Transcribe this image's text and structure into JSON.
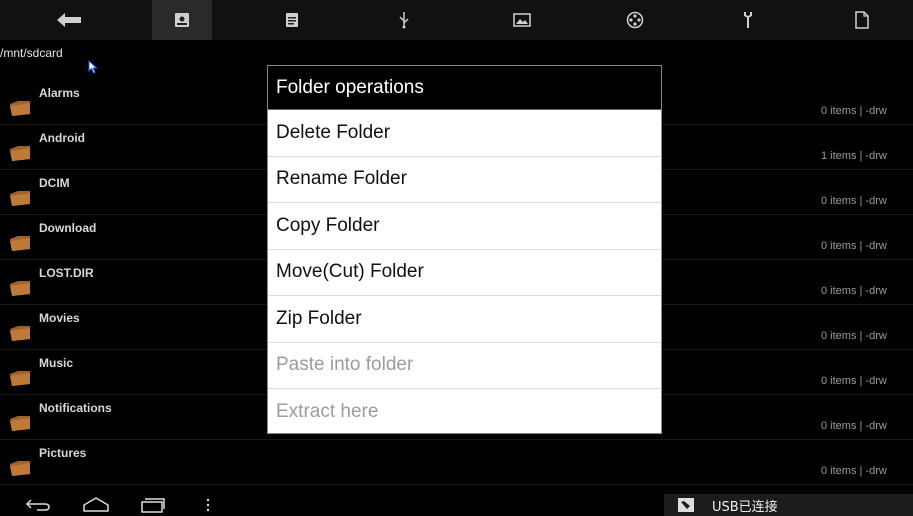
{
  "toolbar": {
    "buttons": [
      {
        "icon": "back-arrow-icon"
      },
      {
        "icon": "sdcard-icon",
        "active": true
      },
      {
        "icon": "document-icon"
      },
      {
        "icon": "usb-icon"
      },
      {
        "icon": "picture-icon"
      },
      {
        "icon": "film-reel-icon"
      },
      {
        "icon": "wrench-icon"
      },
      {
        "icon": "file-icon"
      }
    ]
  },
  "path": "/mnt/sdcard",
  "folders": [
    {
      "name": "Alarms",
      "meta": "0 items | -drw"
    },
    {
      "name": "Android",
      "meta": "1 items | -drw"
    },
    {
      "name": "DCIM",
      "meta": "0 items | -drw"
    },
    {
      "name": "Download",
      "meta": "0 items | -drw"
    },
    {
      "name": "LOST.DIR",
      "meta": "0 items | -drw"
    },
    {
      "name": "Movies",
      "meta": "0 items | -drw"
    },
    {
      "name": "Music",
      "meta": "0 items | -drw"
    },
    {
      "name": "Notifications",
      "meta": "0 items | -drw"
    },
    {
      "name": "Pictures",
      "meta": "0 items | -drw"
    }
  ],
  "dialog": {
    "title": "Folder operations",
    "items": [
      {
        "label": "Delete Folder",
        "enabled": true
      },
      {
        "label": "Rename Folder",
        "enabled": true
      },
      {
        "label": "Copy Folder",
        "enabled": true
      },
      {
        "label": "Move(Cut) Folder",
        "enabled": true
      },
      {
        "label": "Zip Folder",
        "enabled": true
      },
      {
        "label": "Paste into folder",
        "enabled": false
      },
      {
        "label": "Extract here",
        "enabled": false
      }
    ]
  },
  "navbar": {
    "buttons": [
      "back-icon",
      "home-icon",
      "recent-apps-icon",
      "menu-icon"
    ]
  },
  "notification": {
    "text": "USB已连接"
  },
  "colors": {
    "folder": "#a0612a",
    "toolbar_icon": "#cfcfcf",
    "disabled_text": "#9c9c9c"
  }
}
